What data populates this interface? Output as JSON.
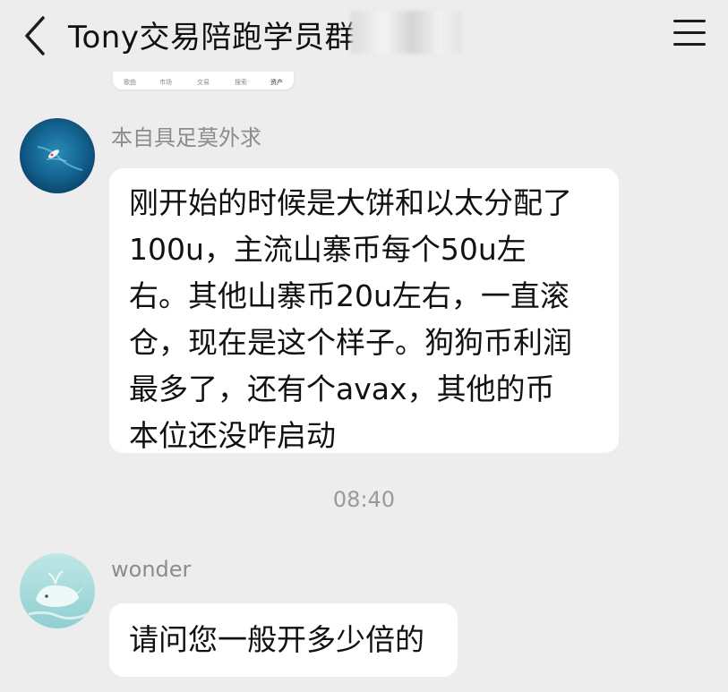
{
  "header": {
    "title": "Tony交易陪跑学员群",
    "back_icon": "chevron-left-icon",
    "menu_icon": "hamburger-menu-icon"
  },
  "image_strip": {
    "tabs": [
      "歌曲",
      "市场",
      "交易",
      "搜索",
      "资产"
    ]
  },
  "messages": [
    {
      "sender": "本自具足莫外求",
      "lines": [
        "刚开始的时候是大饼和以太分配了",
        "100u，主流山寨币每个50u左",
        "右。其他山寨币20u左右，一直滚",
        "仓，现在是这个样子。狗狗币利润",
        "最多了，还有个avax，其他的币",
        "本位还没咋启动"
      ]
    },
    {
      "sender": "wonder",
      "lines": [
        "请问您一般开多少倍的"
      ]
    }
  ],
  "timestamp": "08:40"
}
